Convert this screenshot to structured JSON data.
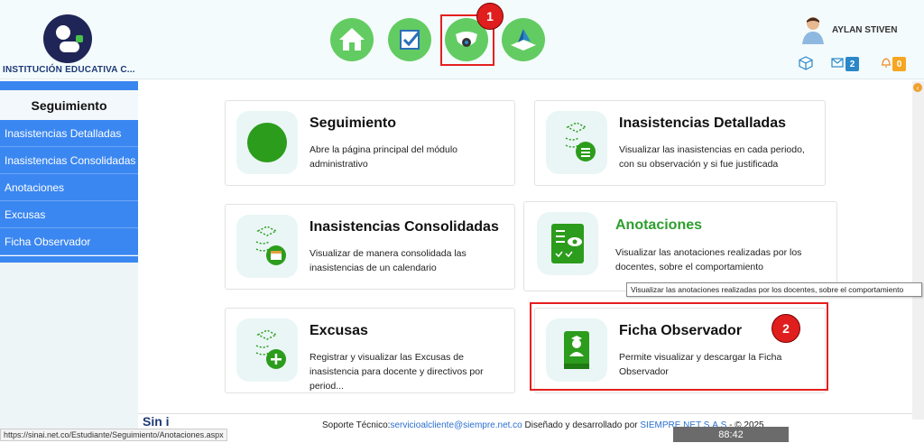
{
  "header": {
    "institution": "INSTITUCIÓN EDUCATIVA C...",
    "nav_icons": [
      "home-icon",
      "checkbox-icon",
      "surveillance-camera-icon",
      "open-book-icon"
    ],
    "annotation_1": "1",
    "user_name": "AYLAN STIVEN",
    "messages_count": "2",
    "notifications_count": "0",
    "colors": {
      "nav_green": "#62cc62",
      "messages_badge": "#2a88c9",
      "notifications_badge": "#f5a623"
    }
  },
  "sidebar": {
    "title": "Seguimiento",
    "items": [
      {
        "label": "Inasistencias Detalladas"
      },
      {
        "label": "Inasistencias Consolidadas"
      },
      {
        "label": "Anotaciones"
      },
      {
        "label": "Excusas"
      },
      {
        "label": "Ficha Observador"
      }
    ]
  },
  "cards": [
    {
      "title": "Seguimiento",
      "desc": "Abre la página principal del módulo administrativo",
      "icon": "green-circle-icon"
    },
    {
      "title": "Inasistencias Detalladas",
      "desc": "Visualizar las inasistencias en cada periodo, con su observación y si fue justificada",
      "icon": "graduation-list-icon"
    },
    {
      "title": "Inasistencias Consolidadas",
      "desc": "Visualizar de manera consolidada las inasistencias de un calendario",
      "icon": "graduation-calendar-icon"
    },
    {
      "title": "Anotaciones",
      "desc": "Visualizar las anotaciones realizadas por los docentes, sobre el comportamiento",
      "icon": "observation-checklist-icon"
    },
    {
      "title": "Excusas",
      "desc": "Registrar y visualizar las Excusas de inasistencia para docente y directivos por period...",
      "icon": "graduation-add-icon"
    },
    {
      "title": "Ficha Observador",
      "desc": "Permite visualizar y descargar la Ficha Observador",
      "icon": "student-book-icon"
    }
  ],
  "annotation_2": "2",
  "tooltip": "Visualizar las anotaciones realizadas por los docentes, sobre el comportamiento",
  "footer": {
    "logo": "Sin i",
    "prefix": "Soporte Técnico:",
    "email": "servicioalcliente@siempre.net.co",
    "middle": " Diseñado y desarrollado por ",
    "company": "SIEMPRE.NET S.A.S",
    "suffix": " - © 2025"
  },
  "status_url": "https://sinai.net.co/Estudiante/Seguimiento/Anotaciones.aspx",
  "timer": "88:42"
}
